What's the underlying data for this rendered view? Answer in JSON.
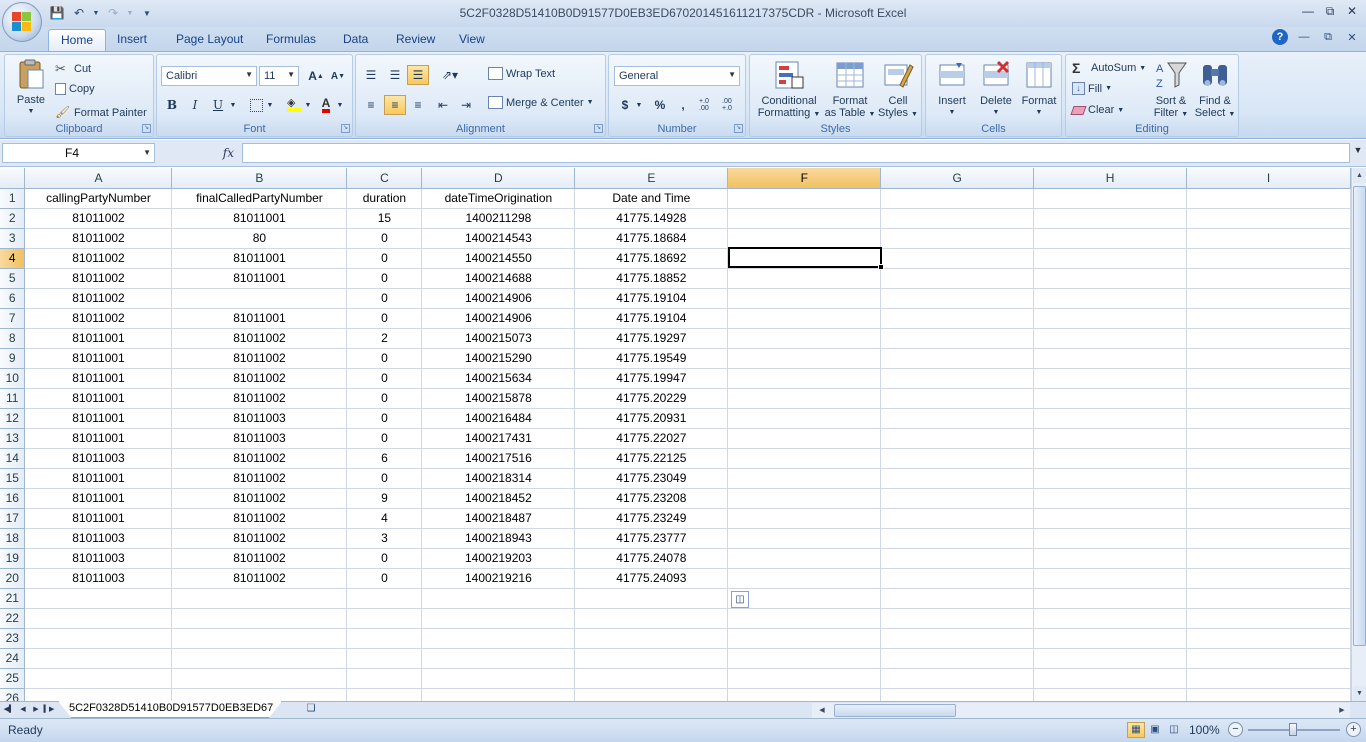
{
  "window": {
    "title": "5C2F0328D51410B0D91577D0EB3ED67020145161121737​5CDR - Microsoft Excel"
  },
  "tabs": [
    "Home",
    "Insert",
    "Page Layout",
    "Formulas",
    "Data",
    "Review",
    "View"
  ],
  "ribbon": {
    "clipboard": {
      "paste": "Paste",
      "cut": "Cut",
      "copy": "Copy",
      "format_painter": "Format Painter",
      "label": "Clipboard"
    },
    "font": {
      "name": "Calibri",
      "size": "11",
      "bold": "B",
      "italic": "I",
      "underline": "U",
      "label": "Font"
    },
    "alignment": {
      "wrap_text": "Wrap Text",
      "merge_center": "Merge & Center",
      "label": "Alignment"
    },
    "number": {
      "format": "General",
      "currency": "$",
      "percent": "%",
      "comma": ",",
      "inc_decimal": "+.0 .00",
      "dec_decimal": ".00 +.0",
      "label": "Number"
    },
    "styles": {
      "conditional": "Conditional",
      "conditional2": "Formatting",
      "format_table": "Format",
      "format_table2": "as Table",
      "cell_styles": "Cell",
      "cell_styles2": "Styles",
      "label": "Styles"
    },
    "cells": {
      "insert": "Insert",
      "delete": "Delete",
      "format": "Format",
      "label": "Cells"
    },
    "editing": {
      "autosum": "AutoSum",
      "fill": "Fill",
      "clear": "Clear",
      "sort": "Sort &",
      "sort2": "Filter",
      "find": "Find &",
      "find2": "Select",
      "label": "Editing"
    }
  },
  "formula_bar": {
    "name_box": "F4",
    "fx": "fx",
    "value": ""
  },
  "grid": {
    "columns": [
      "A",
      "B",
      "C",
      "D",
      "E",
      "F",
      "G",
      "H",
      "I"
    ],
    "selected_column": "F",
    "selected_row": 4,
    "row_numbers": [
      1,
      2,
      3,
      4,
      5,
      6,
      7,
      8,
      9,
      10,
      11,
      12,
      13,
      14,
      15,
      16,
      17,
      18,
      19,
      20,
      21,
      22,
      23,
      24,
      25,
      26
    ],
    "header_row": [
      "callingPartyNumber",
      "finalCalledPartyNumber",
      "duration",
      "dateTimeOrigination",
      "Date and Time"
    ],
    "rows": [
      [
        "81011002",
        "81011001",
        "15",
        "1400211298",
        "41775.14928"
      ],
      [
        "81011002",
        "80",
        "0",
        "1400214543",
        "41775.18684"
      ],
      [
        "81011002",
        "81011001",
        "0",
        "1400214550",
        "41775.18692"
      ],
      [
        "81011002",
        "81011001",
        "0",
        "1400214688",
        "41775.18852"
      ],
      [
        "81011002",
        "",
        "0",
        "1400214906",
        "41775.19104"
      ],
      [
        "81011002",
        "81011001",
        "0",
        "1400214906",
        "41775.19104"
      ],
      [
        "81011001",
        "81011002",
        "2",
        "1400215073",
        "41775.19297"
      ],
      [
        "81011001",
        "81011002",
        "0",
        "1400215290",
        "41775.19549"
      ],
      [
        "81011001",
        "81011002",
        "0",
        "1400215634",
        "41775.19947"
      ],
      [
        "81011001",
        "81011002",
        "0",
        "1400215878",
        "41775.20229"
      ],
      [
        "81011001",
        "81011003",
        "0",
        "1400216484",
        "41775.20931"
      ],
      [
        "81011001",
        "81011003",
        "0",
        "1400217431",
        "41775.22027"
      ],
      [
        "81011003",
        "81011002",
        "6",
        "1400217516",
        "41775.22125"
      ],
      [
        "81011001",
        "81011002",
        "0",
        "1400218314",
        "41775.23049"
      ],
      [
        "81011001",
        "81011002",
        "9",
        "1400218452",
        "41775.23208"
      ],
      [
        "81011001",
        "81011002",
        "4",
        "1400218487",
        "41775.23249"
      ],
      [
        "81011003",
        "81011002",
        "3",
        "1400218943",
        "41775.23777"
      ],
      [
        "81011003",
        "81011002",
        "0",
        "1400219203",
        "41775.24078"
      ],
      [
        "81011003",
        "81011002",
        "0",
        "1400219216",
        "41775.24093"
      ]
    ]
  },
  "sheet_tab": "5C2F0328D51410B0D91577D0EB3ED67",
  "status": {
    "text": "Ready",
    "zoom": "100%"
  },
  "colors": {
    "accent": "#f1c15f",
    "ribbon": "#d8e6f6",
    "grid_line": "#d0d7e5"
  }
}
